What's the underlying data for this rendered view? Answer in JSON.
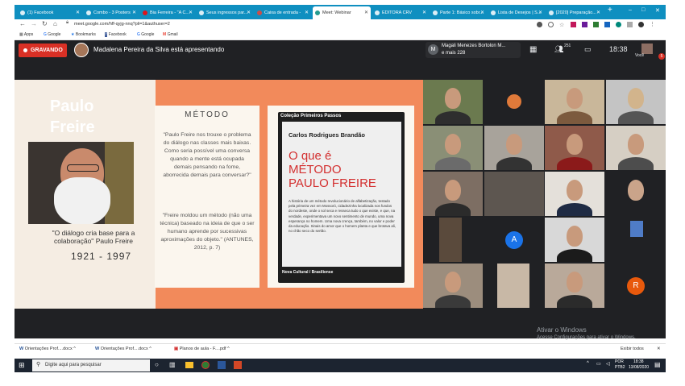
{
  "browser": {
    "tabs": [
      {
        "label": "(1) Facebook"
      },
      {
        "label": "Combo - 3 Posters"
      },
      {
        "label": "Bia Ferreira - \"A C..."
      },
      {
        "label": "Seus ingressos par..."
      },
      {
        "label": "Caixa de entrada -"
      },
      {
        "label": "Meet: Webinar"
      },
      {
        "label": "EDITORA CRV"
      },
      {
        "label": "Parte 1: Básico sobr..."
      },
      {
        "label": "Lista de Desejos | S..."
      },
      {
        "label": "[2020] Preparação..."
      }
    ],
    "new_tab": "+",
    "window_controls": {
      "minimize": "–",
      "maximize": "□",
      "close": "✕"
    },
    "url": "meet.google.com/hff-qyjg-nnq?pli=1&authuser=2",
    "bookmarks": [
      {
        "label": "Apps"
      },
      {
        "label": "Google"
      },
      {
        "label": "Bookmarks"
      },
      {
        "label": "Facebook"
      },
      {
        "label": "Google"
      },
      {
        "label": "Gmail"
      }
    ]
  },
  "meet": {
    "recording_label": "GRAVANDO",
    "presenter_text": "Madalena Pereira da Silva está apresentando",
    "participant_name": "Magali Menezes Bortolon M...",
    "participant_more": "e mais 228",
    "participant_initial": "M",
    "people_count": "251",
    "clock": "18:38",
    "you_label": "Você",
    "notification_count": "5",
    "tile_letters": {
      "a": "A",
      "r": "R"
    },
    "colors": {
      "recording": "#d93025",
      "avatar_a": "#1a73e8",
      "avatar_r": "#e8590c"
    }
  },
  "slide": {
    "title_line1": "Paulo",
    "title_line2": "Freire",
    "quote": "\"O diálogo cria base para a colaboração\" Paulo Freire",
    "years": "1921 - 1997",
    "method_heading": "MÉTODO",
    "method_text1": "\"Paulo Freire nos trouxe o problema do diálogo nas classes mais baixas. Como seria possível uma conversa quando a mente está ocupada demais pensando na fome, aborrecida demais para conversar?\"",
    "method_text2": "\"Freire moldou um método (não uma técnica) baseado na ideia de que o ser humano aprende por sucessivas aproximações do objeto.\" (ANTUNES, 2012, p. 7)",
    "book": {
      "series": "Coleção Primeiros Passos",
      "author": "Carlos Rodrigues Brandão",
      "title_line1": "O que é",
      "title_line2": "MÉTODO",
      "title_line3": "PAULO FREIRE",
      "blurb": "A história de um método revolucionário de alfabetização, testado pela primeira vez em Mossoró, cidadezinha localizada nos fundos do nordeste, onde o sol seca e resseca tudo o que existe, e que, na verdade, experimentava um novo sentimento de mundo, uma nova esperança no homem. Uma nova crença, também, no valor e poder da educação. Sinais do amor que o homem planta e que brotava ali, no chão seco do sertão.",
      "publisher": "Nova Cultural / Brasiliense"
    }
  },
  "windows_watermark": {
    "line1": "Ativar o Windows",
    "line2": "Acesse Configurações para ativar o Windows."
  },
  "downloads": {
    "items": [
      {
        "label": "Orientações Prof....docx"
      },
      {
        "label": "Orientações Prof....docx"
      },
      {
        "label": "Planos de aula - F....pdf"
      }
    ],
    "show_all": "Exibir todos",
    "close": "✕"
  },
  "taskbar": {
    "search_placeholder": "Digite aqui para pesquisar",
    "lang_top": "POR",
    "lang_bottom": "PTB2",
    "time": "18:38",
    "date": "13/08/2020"
  }
}
